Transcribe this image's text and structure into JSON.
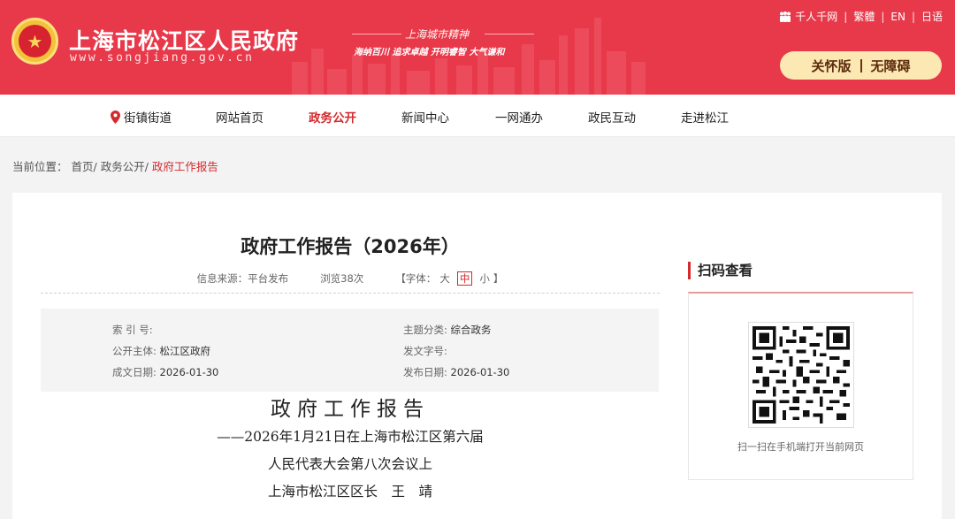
{
  "header": {
    "title": "上海市松江区人民政府",
    "url": "www.songjiang.gov.cn",
    "spirit_title": "上海城市精神",
    "spirit_motto": "海纳百川  追求卓越  开明睿智  大气谦和",
    "emblem_icon": "national-emblem-icon",
    "top_links": [
      "千人千网",
      "繁體",
      "EN",
      "日语"
    ],
    "care_mode": "关怀版",
    "accessible_mode": "无障碍",
    "colors": {
      "brand_red": "#e8394a",
      "accent_gold": "#fbe8b2"
    }
  },
  "nav": {
    "items": [
      "街镇街道",
      "网站首页",
      "政务公开",
      "新闻中心",
      "一网通办",
      "政民互动",
      "走进松江"
    ],
    "active_index": 2
  },
  "breadcrumb": {
    "prefix": "当前位置：",
    "home": "首页/",
    "section": "政务公开/",
    "current": "政府工作报告"
  },
  "article": {
    "title": "政府工作报告（2026年）",
    "source": "信息来源：平台发布",
    "views": "浏览38次",
    "font_label": "【字体：",
    "font_large": "大",
    "font_medium": "中",
    "font_small": "小",
    "font_close": "】",
    "info": {
      "index_label": "索 引 号:",
      "index_value": "",
      "category_label": "主题分类:",
      "category_value": "综合政务",
      "publisher_label": "公开主体:",
      "publisher_value": "松江区政府",
      "doc_no_label": "发文字号:",
      "doc_no_value": "",
      "created_label": "成文日期:",
      "created_value": "2026-01-30",
      "published_label": "发布日期:",
      "published_value": "2026-01-30"
    },
    "body": {
      "heading": "政府工作报告",
      "line1": "——2026年1月21日在上海市松江区第六届",
      "line2": "人民代表大会第八次会议上",
      "line3": "上海市松江区区长　王　靖"
    }
  },
  "sidebar": {
    "heading": "扫码查看",
    "caption": "扫一扫在手机端打开当前网页"
  }
}
